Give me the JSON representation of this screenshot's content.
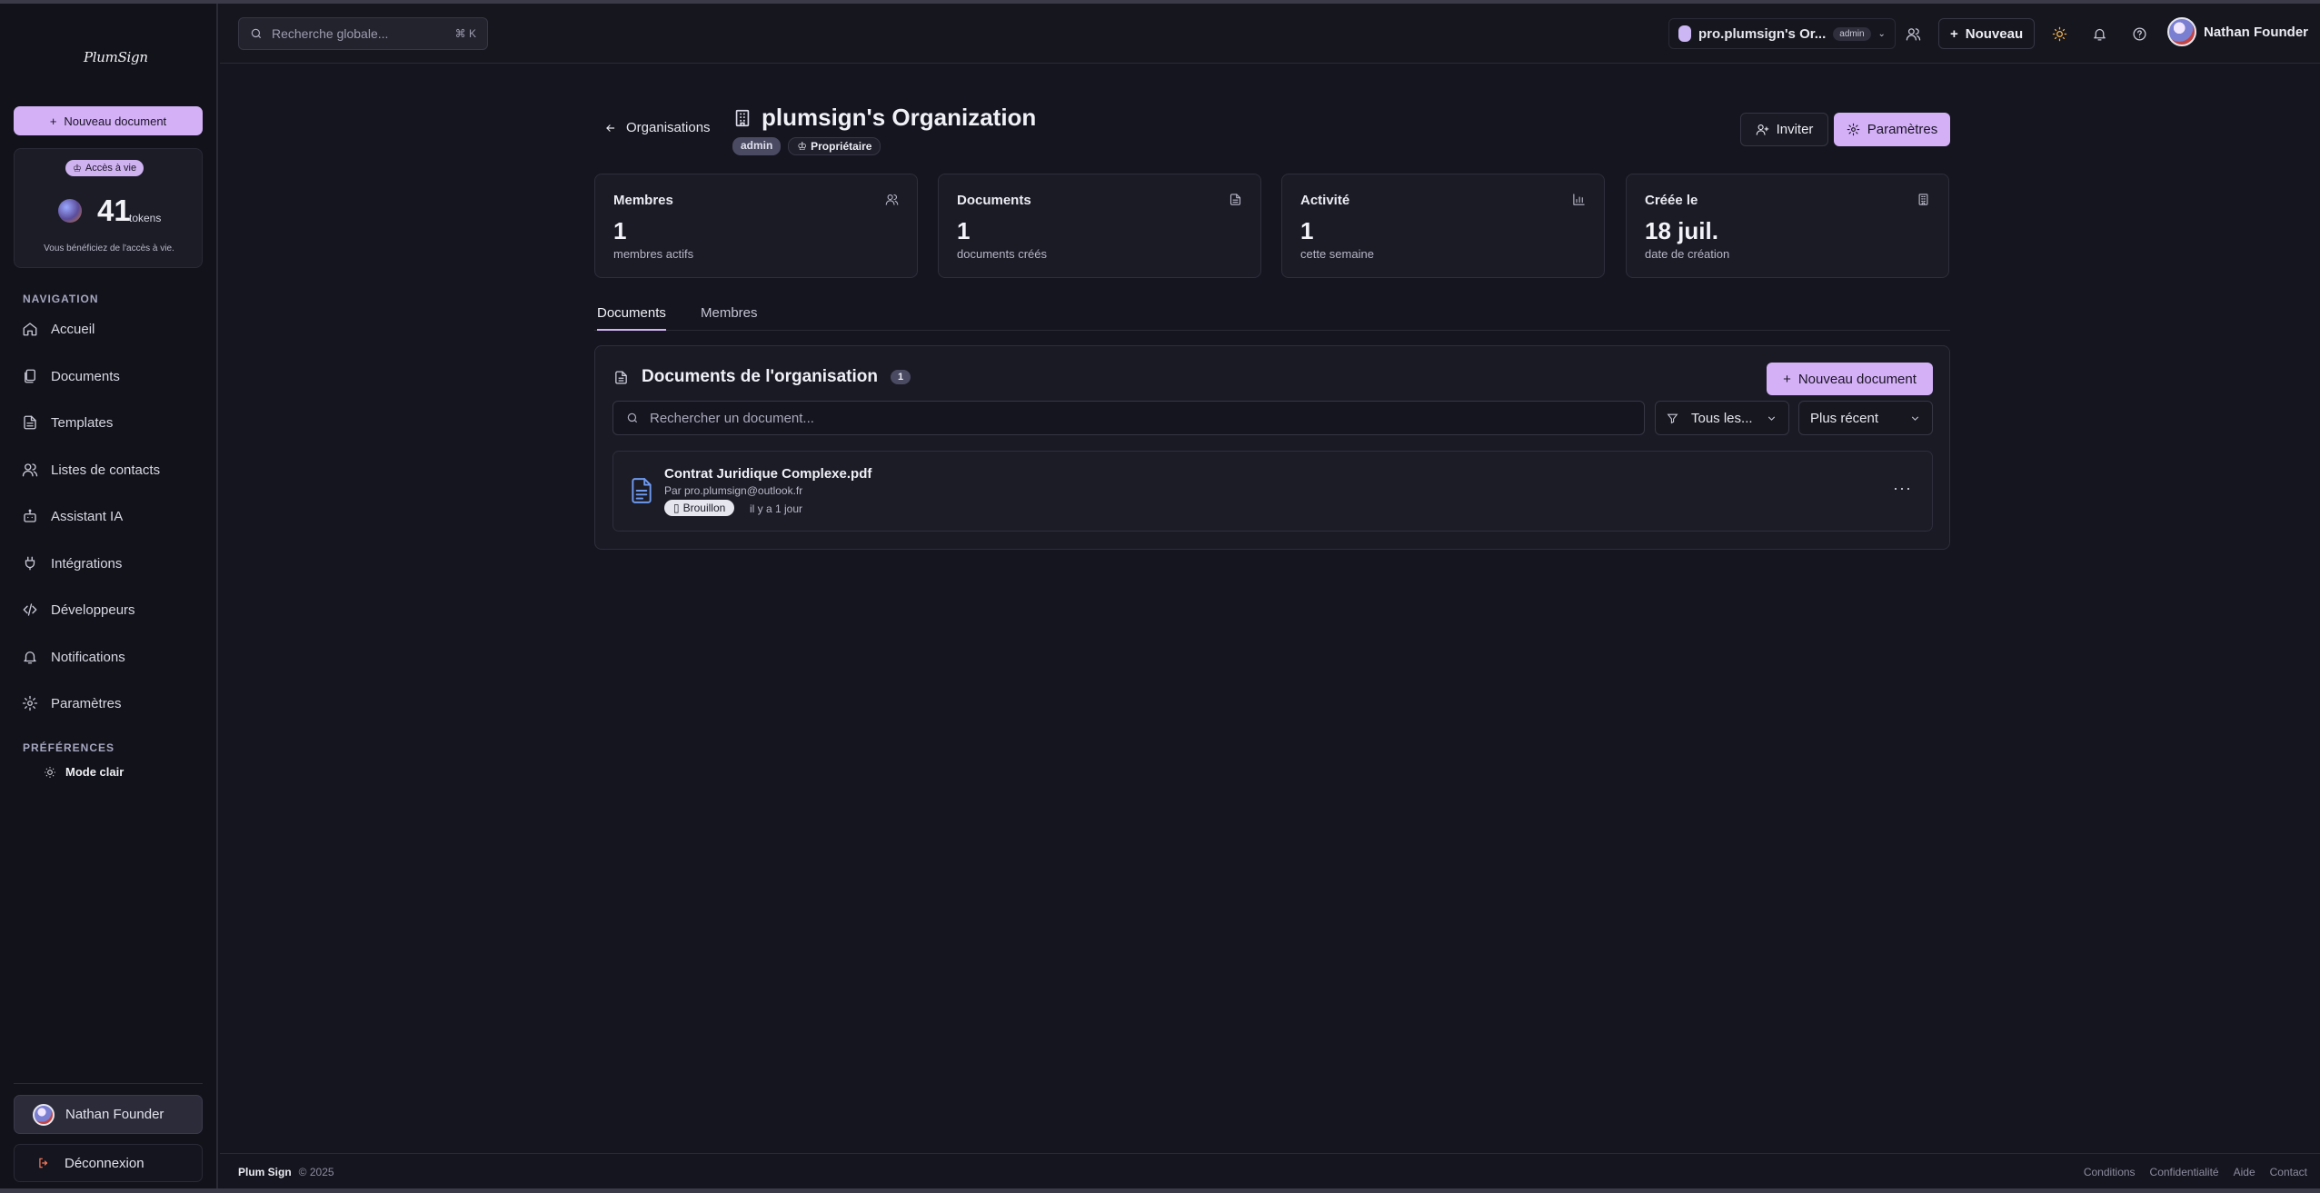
{
  "sidebar": {
    "logo": "PlumSign",
    "new_document": "Nouveau document",
    "access": {
      "badge": "Accès à vie",
      "tokens": "41",
      "tokens_label": "tokens",
      "note": "Vous bénéficiez de l'accès à vie."
    },
    "nav_label": "NAVIGATION",
    "nav_items": [
      {
        "label": "Accueil",
        "icon": "home-icon"
      },
      {
        "label": "Documents",
        "icon": "documents-icon"
      },
      {
        "label": "Templates",
        "icon": "template-icon"
      },
      {
        "label": "Listes de contacts",
        "icon": "contacts-icon"
      },
      {
        "label": "Assistant IA",
        "icon": "bot-icon"
      },
      {
        "label": "Intégrations",
        "icon": "plug-icon"
      },
      {
        "label": "Développeurs",
        "icon": "code-icon"
      },
      {
        "label": "Notifications",
        "icon": "bell-icon"
      },
      {
        "label": "Paramètres",
        "icon": "gear-icon"
      }
    ],
    "prefs_label": "PRÉFÉRENCES",
    "mode_label": "Mode clair",
    "user_name": "Nathan Founder",
    "logout": "Déconnexion"
  },
  "topbar": {
    "search_placeholder": "Recherche globale...",
    "search_shortcut": "⌘ K",
    "org_name": "pro.plumsign's Or...",
    "org_role": "admin",
    "new_label": "Nouveau",
    "user_name": "Nathan Founder"
  },
  "org": {
    "back_label": "Organisations",
    "title": "plumsign's Organization",
    "badge_admin": "admin",
    "badge_owner": "Propriétaire",
    "invite_label": "Inviter",
    "settings_label": "Paramètres"
  },
  "stats": [
    {
      "title": "Membres",
      "value": "1",
      "sub": "membres actifs",
      "icon": "users-icon"
    },
    {
      "title": "Documents",
      "value": "1",
      "sub": "documents créés",
      "icon": "document-icon"
    },
    {
      "title": "Activité",
      "value": "1",
      "sub": "cette semaine",
      "icon": "bar-chart-icon"
    },
    {
      "title": "Créée le",
      "value": "18 juil.",
      "sub": "date de création",
      "icon": "building-icon"
    }
  ],
  "tabs": [
    {
      "label": "Documents",
      "active": true
    },
    {
      "label": "Membres",
      "active": false
    }
  ],
  "documents_panel": {
    "title": "Documents de l'organisation",
    "count": "1",
    "new_label": "Nouveau document",
    "search_placeholder": "Rechercher un document...",
    "filter_value": "Tous les...",
    "sort_value": "Plus récent",
    "items": [
      {
        "name": "Contrat Juridique Complexe.pdf",
        "author": "Par pro.plumsign@outlook.fr",
        "status": "Brouillon",
        "time": "il y a 1 jour"
      }
    ]
  },
  "footer": {
    "brand": "Plum Sign",
    "copyright": "© 2025",
    "links": [
      "Conditions",
      "Confidentialité",
      "Aide",
      "Contact"
    ]
  },
  "colors": {
    "accent": "#d4b1f7",
    "background": "#15151f",
    "sidebar": "#12121a",
    "card": "#1b1b26",
    "file_icon": "#6f9af0"
  }
}
